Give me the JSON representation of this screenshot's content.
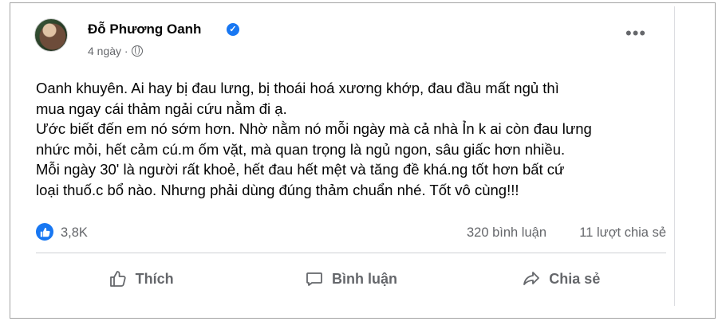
{
  "post": {
    "author": "Đỗ Phương Oanh",
    "time": "4 ngày ·",
    "lines": [
      "Oanh khuyên. Ai hay bị đau lưng, bị thoái hoá xương khớp, đau đầu mất ngủ thì",
      "mua ngay cái thảm ngải cứu nằm đi ạ.",
      "Ước biết đến em nó sớm hơn. Nhờ nằm nó mỗi ngày mà cả nhà Ỉn k ai còn đau lưng",
      "nhức mỏi, hết cảm cú.m ốm vặt, mà quan trọng là ngủ ngon, sâu giấc hơn nhiều.",
      "Mỗi ngày 30' là người rất khoẻ, hết đau hết mệt và tăng đề khá.ng tốt hơn bất cứ",
      "loại thuố.c bổ nào. Nhưng phải dùng đúng thảm chuẩn nhé. Tốt vô cùng!!!"
    ]
  },
  "stats": {
    "likes": "3,8K",
    "comments": "320 bình luận",
    "shares": "11 lượt chia sẻ"
  },
  "actions": {
    "like": "Thích",
    "comment": "Bình luận",
    "share": "Chia sẻ"
  },
  "icons": {
    "verified": "verified-badge-icon",
    "privacy": "globe-icon",
    "more": "more-options-icon",
    "like_reaction": "thumbs-up-icon"
  },
  "colors": {
    "accent": "#1877f2",
    "secondary_text": "#65676b"
  }
}
